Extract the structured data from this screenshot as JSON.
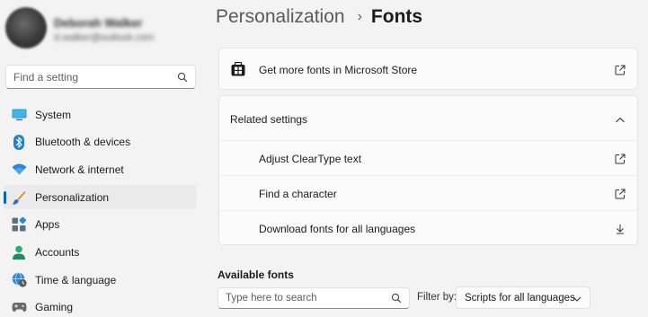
{
  "profile": {
    "name": "Deborah Walker",
    "email": "d.walker@outlook.com"
  },
  "search": {
    "placeholder": "Find a setting"
  },
  "sidebar": {
    "items": [
      {
        "label": "System",
        "icon": "system-icon"
      },
      {
        "label": "Bluetooth & devices",
        "icon": "bluetooth-icon"
      },
      {
        "label": "Network & internet",
        "icon": "wifi-icon"
      },
      {
        "label": "Personalization",
        "icon": "brush-icon",
        "active": true
      },
      {
        "label": "Apps",
        "icon": "apps-icon"
      },
      {
        "label": "Accounts",
        "icon": "person-icon"
      },
      {
        "label": "Time & language",
        "icon": "globe-clock-icon"
      },
      {
        "label": "Gaming",
        "icon": "gaming-icon"
      }
    ]
  },
  "breadcrumb": {
    "parent": "Personalization",
    "separator": "›",
    "current": "Fonts"
  },
  "store": {
    "label": "Get more fonts in Microsoft Store",
    "icon": "store-icon"
  },
  "related": {
    "title": "Related settings",
    "items": [
      {
        "label": "Adjust ClearType text",
        "icon": "external-link-icon"
      },
      {
        "label": "Find a character",
        "icon": "external-link-icon"
      },
      {
        "label": "Download fonts for all languages",
        "icon": "download-icon"
      }
    ]
  },
  "available_fonts": {
    "title": "Available fonts",
    "search_placeholder": "Type here to search",
    "filter_label": "Filter by:",
    "filter_value": "Scripts for all languages"
  },
  "colors": {
    "accent": "#0067c0",
    "background": "#f3f3f3",
    "card": "#fbfbfb"
  }
}
